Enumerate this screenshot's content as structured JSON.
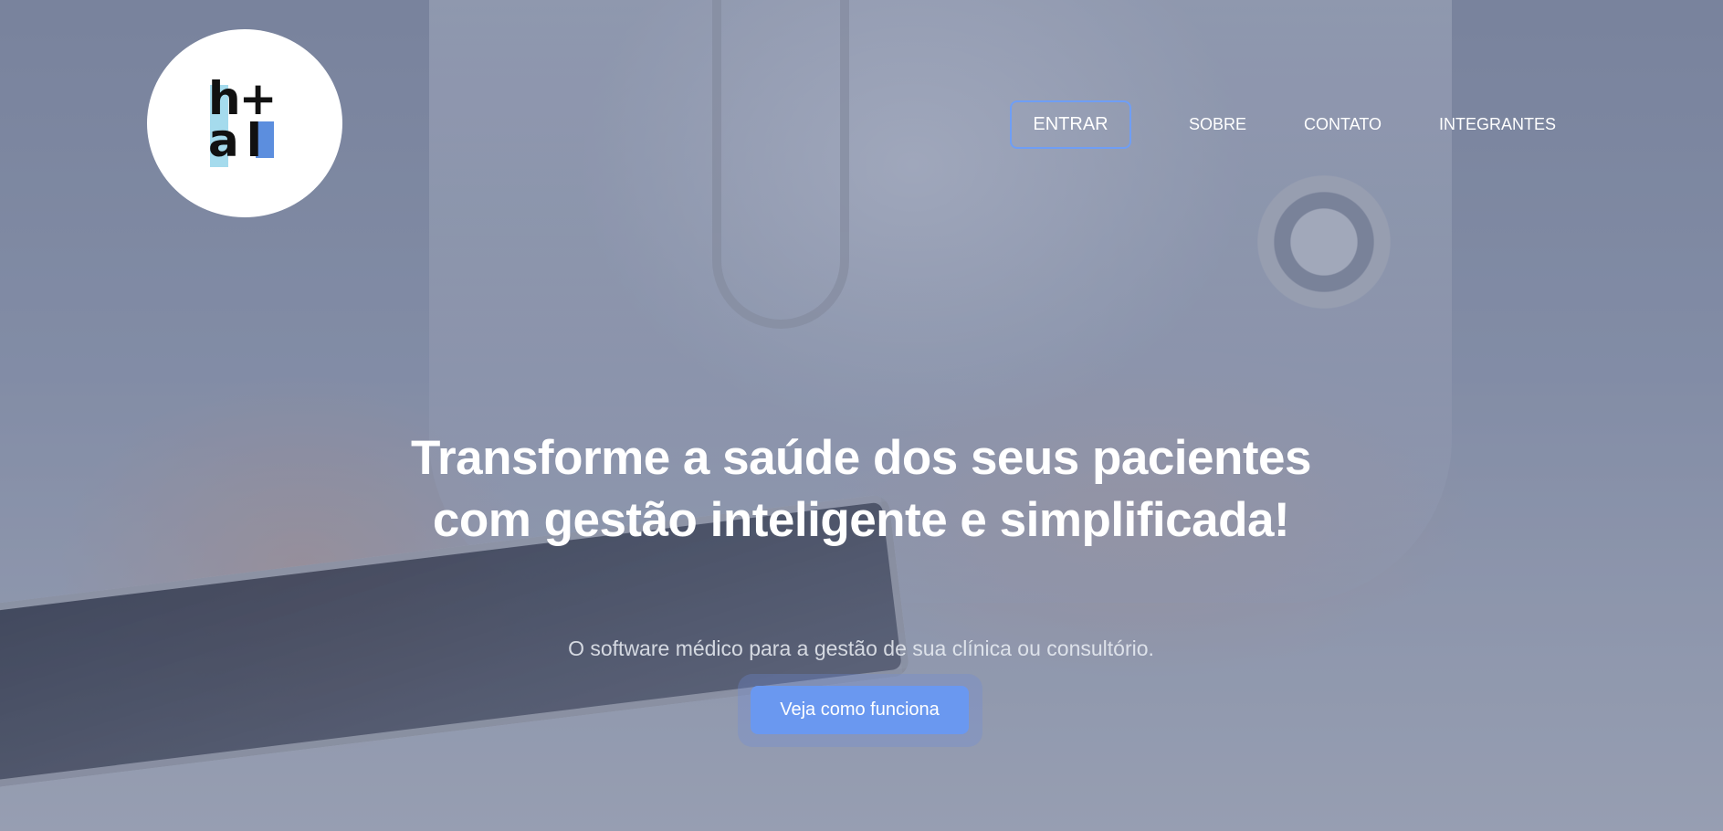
{
  "brand": {
    "logo_line1": "h+",
    "logo_line2": "al",
    "logo_icon": "heal-logo"
  },
  "nav": {
    "login_label": "ENTRAR",
    "links": [
      {
        "label": "SOBRE"
      },
      {
        "label": "CONTATO"
      },
      {
        "label": "INTEGRANTES"
      }
    ]
  },
  "hero": {
    "headline": "Transforme a saúde dos seus pacientes com gestão inteligente e simplificada!",
    "subtitle": "O software médico para a gestão de sua clínica ou consultório.",
    "cta_label": "Veja como funciona"
  },
  "colors": {
    "accent": "#6a98f0",
    "overlay": "#505c80"
  }
}
